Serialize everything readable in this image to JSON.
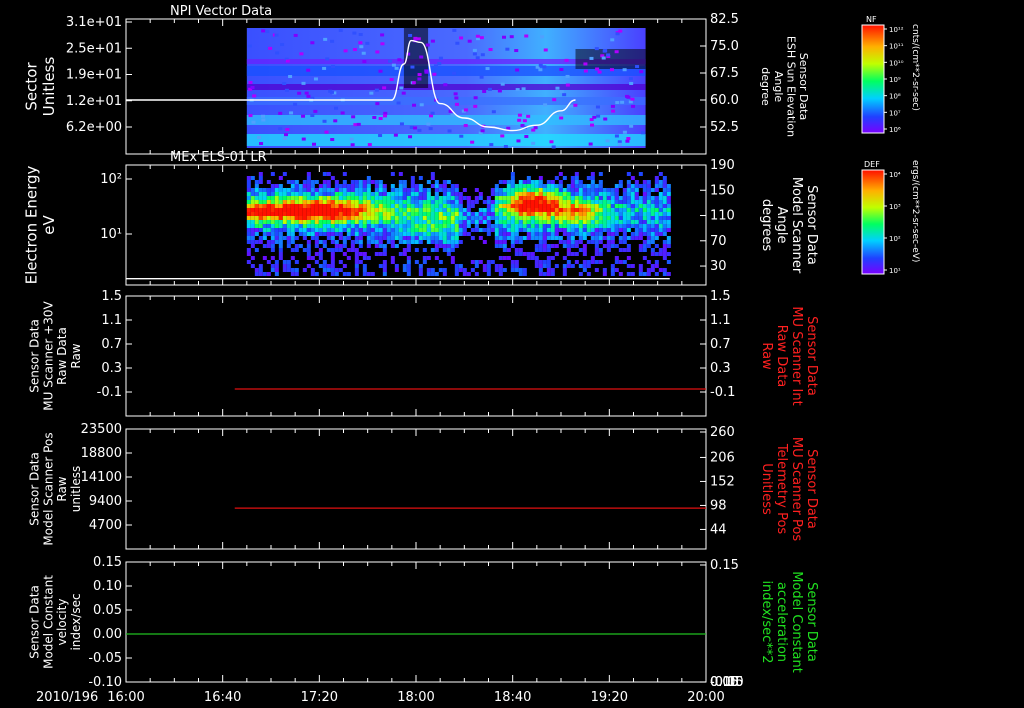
{
  "chart_data": {
    "type": "multi-panel time series",
    "date_label": "2010/196",
    "x": {
      "range": [
        "16:00",
        "20:00"
      ],
      "ticks": [
        "16:00",
        "16:40",
        "17:20",
        "18:00",
        "18:40",
        "19:20",
        "20:00"
      ]
    },
    "panels": [
      {
        "id": "npi",
        "type": "heatmap",
        "title": "NPI Vector Data",
        "ylabel": [
          "Sector",
          "Unitless"
        ],
        "yticks": [
          "3.1e+01",
          "2.5e+01",
          "1.9e+01",
          "1.2e+01",
          "6.2e+00"
        ],
        "right_ylabel": [
          "Sensor Data",
          "ESH Sun Elevation",
          "Angle",
          "degree"
        ],
        "right_yticks": [
          "82.5",
          "75.0",
          "67.5",
          "60.0",
          "52.5"
        ],
        "right_ylim": [
          45,
          82.5
        ],
        "colorbar": {
          "label": "NF",
          "unit": "cnts/(cm**2-sr-sec)",
          "ticks": [
            "10¹²",
            "10¹¹",
            "10¹⁰",
            "10⁹",
            "10⁸",
            "10⁷",
            "10⁶"
          ]
        },
        "data_start": "16:50",
        "data_end": "19:35",
        "overlay": {
          "name": "ESH Sun Elevation Angle",
          "color": "#ffffff",
          "x": [
            "16:00",
            "17:30",
            "17:50",
            "17:55",
            "17:58",
            "18:02",
            "18:10",
            "18:20",
            "18:30",
            "18:40",
            "18:50",
            "19:00",
            "19:06"
          ],
          "y": [
            60.0,
            60.0,
            60.0,
            70.0,
            76.5,
            76.0,
            59.0,
            55.0,
            52.5,
            51.5,
            53.0,
            57.0,
            60.0
          ]
        }
      },
      {
        "id": "els",
        "type": "heatmap",
        "title": "MEx ELS-01 LR",
        "ylabel": [
          "Electron Energy",
          "eV"
        ],
        "yticks": [
          "10²",
          "10¹"
        ],
        "right_ylabel": [
          "Sensor Data",
          "Model Scanner",
          "Angle",
          "degrees"
        ],
        "right_yticks": [
          "190",
          "150",
          "110",
          "70",
          "30"
        ],
        "right_ylim": [
          0,
          190
        ],
        "colorbar": {
          "label": "DEF",
          "unit": "ergs/(cm**2-sr-sec-eV)",
          "ticks": [
            "10⁴",
            "10³",
            "10²",
            "10¹"
          ]
        },
        "data_start": "16:50",
        "data_end": "19:45",
        "overlay": {
          "name": "Model Scanner Angle",
          "color": "#ffffff",
          "x": [
            "16:00",
            "19:45"
          ],
          "y": [
            10,
            10
          ]
        }
      },
      {
        "id": "mu-raw",
        "type": "line",
        "ylabel": [
          "Sensor Data",
          "MU Scanner +30V",
          "Raw Data",
          "Raw"
        ],
        "yticks": [
          "1.5",
          "1.1",
          "0.7",
          "0.3",
          "-0.1"
        ],
        "ylim": [
          -0.5,
          1.5
        ],
        "right_ylabel": [
          "Sensor Data",
          "MU Scanner Int",
          "Raw Data",
          "Raw"
        ],
        "right_yticks": [
          "1.5",
          "1.1",
          "0.7",
          "0.3",
          "-0.1"
        ],
        "right_label_color": "#ff2020",
        "series": [
          {
            "color": "#e01010",
            "x": [
              "16:45",
              "20:00"
            ],
            "y": [
              -0.05,
              -0.05
            ]
          }
        ]
      },
      {
        "id": "mu-pos",
        "type": "line",
        "ylabel": [
          "Sensor Data",
          "Model Scanner Pos",
          "Raw",
          "unitless"
        ],
        "yticks": [
          "23500",
          "18800",
          "14100",
          "9400",
          "4700"
        ],
        "ylim": [
          0,
          23500
        ],
        "right_ylabel": [
          "Sensor Data",
          "MU Scanner Pos",
          "Telemetry Pos",
          "Unitless"
        ],
        "right_yticks": [
          "260",
          "206",
          "152",
          "98",
          "44"
        ],
        "right_label_color": "#ff2020",
        "series": [
          {
            "color": "#e01010",
            "x": [
              "16:45",
              "20:00"
            ],
            "y": [
              8000,
              8000
            ]
          }
        ]
      },
      {
        "id": "velocity",
        "type": "line",
        "ylabel": [
          "Sensor Data",
          "Model Constant",
          "velocity",
          "index/sec"
        ],
        "yticks": [
          "0.15",
          "0.10",
          "0.05",
          "0.00",
          "-0.05",
          "-0.10"
        ],
        "ylim": [
          -0.1,
          0.15
        ],
        "right_ylabel": [
          "Sensor Data",
          "Model Constant",
          "acceleration",
          "index/sec**2"
        ],
        "right_yticks": [
          "0.15",
          "0.10",
          "0.05",
          "0.00",
          "-0.05",
          "-0.10"
        ],
        "right_label_color": "#20e020",
        "series": [
          {
            "color": "#20c020",
            "x": [
              "16:00",
              "20:00"
            ],
            "y": [
              0.0,
              0.0
            ]
          }
        ]
      }
    ]
  }
}
